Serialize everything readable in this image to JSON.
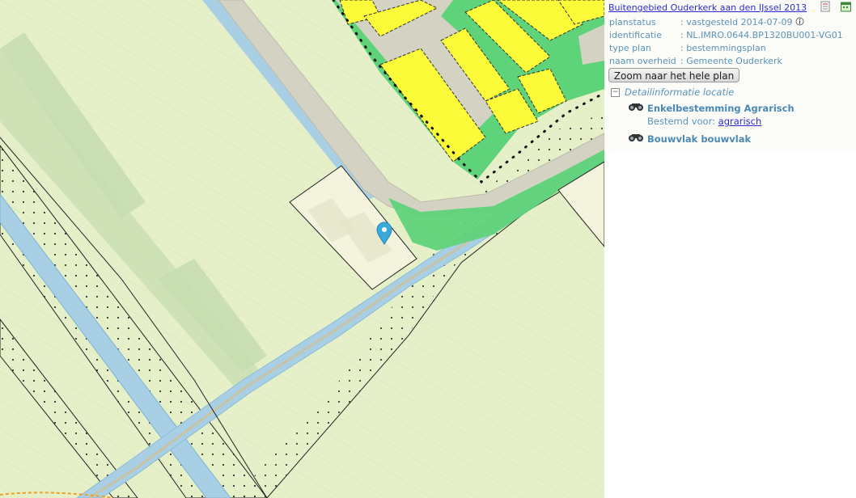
{
  "map": {
    "marker_icon": "map-pin-icon",
    "colors": {
      "agrarisch": "#e5efc8",
      "water": "#a9cfe5",
      "wonen": "#fbfb3a",
      "groen": "#5fd37a",
      "verkeer": "#cfcfbf",
      "bouwvlak": "#f4f4de",
      "marker": "#3aa8d8"
    }
  },
  "panel": {
    "plan_title": "Buitengebied Ouderkerk aan den IJssel 2013",
    "header_icons": [
      "document-icon",
      "calendar-icon"
    ],
    "fields": [
      {
        "label": "planstatus",
        "value": ": vastgesteld 2014-07-09"
      },
      {
        "label": "identificatie",
        "value": ": NL.IMRO.0644.BP1320BU001-VG01"
      },
      {
        "label": "type plan",
        "value": ": bestemmingsplan"
      },
      {
        "label": "naam overheid",
        "value": ": Gemeente Ouderkerk"
      }
    ],
    "zoom_button": "Zoom naar het hele plan",
    "tree_toggle": "−",
    "detail_label": "Detailinformatie locatie",
    "items": [
      {
        "title": "Enkelbestemming Agrarisch",
        "sub_label": "Bestemd voor:",
        "sub_link": "agrarisch"
      },
      {
        "title": "Bouwvlak bouwvlak"
      }
    ]
  }
}
